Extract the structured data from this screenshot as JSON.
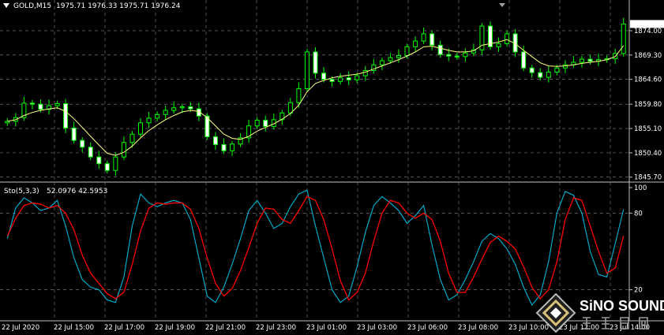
{
  "chart_header": {
    "symbol_label": "GOLD,M15",
    "ohlc_label": "1975.71 1976.33 1975.71 1976.24"
  },
  "indicator_header": {
    "name_label": "Sto(5,3,3)",
    "values_label": "52.0976 42.5953"
  },
  "watermark": {
    "brand_text": "SiNO SOUND"
  },
  "colors": {
    "background": "#000000",
    "grid": "#c0c0c0",
    "candle": "#00ff00",
    "moving_average": "#ffff80",
    "stoch_main": "#00b4d8",
    "stoch_signal": "#ff0000",
    "axis_text": "#ffffff"
  },
  "chart_data": [
    {
      "type": "candlestick",
      "title": "GOLD,M15",
      "y_ticks": [
        1845.7,
        1850.4,
        1855.1,
        1859.8,
        1864.6,
        1869.3,
        1874.0
      ],
      "ylim": [
        1845.2,
        1877.5
      ],
      "x_ticks": [
        "22 Jul 2020",
        "22 Jul 15:00",
        "22 Jul 17:00",
        "22 Jul 19:00",
        "22 Jul 21:00",
        "22 Jul 23:00",
        "23 Jul 01:00",
        "23 Jul 03:00",
        "23 Jul 06:00",
        "23 Jul 08:00",
        "23 Jul 10:00",
        "23 Jul 12:00",
        "23 Jul 14:00"
      ],
      "grid": true,
      "series": [
        {
          "kind": "close",
          "values": [
            1856.5,
            1857.2,
            1860.0,
            1859.8,
            1858.8,
            1859.5,
            1859.9,
            1855.2,
            1852.8,
            1851.5,
            1849.6,
            1848.3,
            1847.0,
            1849.6,
            1852.4,
            1854.0,
            1856.2,
            1857.1,
            1857.8,
            1858.6,
            1859.1,
            1859.3,
            1858.9,
            1857.5,
            1853.5,
            1852.0,
            1850.8,
            1852.1,
            1853.3,
            1855.6,
            1856.7,
            1855.5,
            1856.8,
            1858.1,
            1860.1,
            1862.8,
            1869.9,
            1865.8,
            1864.6,
            1864.2,
            1864.9,
            1864.5,
            1865.3,
            1866.3,
            1867.4,
            1868.2,
            1868.8,
            1869.2,
            1870.9,
            1872.0,
            1873.4,
            1871.2,
            1869.4,
            1869.1,
            1869.0,
            1869.7,
            1870.3,
            1874.9,
            1870.9,
            1871.5,
            1873.4,
            1869.9,
            1866.8,
            1865.9,
            1865.0,
            1866.0,
            1866.8,
            1867.4,
            1867.9,
            1868.5,
            1868.1,
            1868.4,
            1868.6,
            1869.6,
            1875.3
          ]
        },
        {
          "kind": "moving_average",
          "values": [
            1856.5,
            1856.8,
            1857.6,
            1858.2,
            1858.6,
            1858.9,
            1859.1,
            1858.4,
            1857.0,
            1855.3,
            1853.6,
            1851.9,
            1850.3,
            1849.9,
            1850.5,
            1851.7,
            1853.3,
            1854.7,
            1855.8,
            1856.8,
            1857.6,
            1858.3,
            1858.6,
            1858.4,
            1857.2,
            1855.6,
            1854.0,
            1853.2,
            1853.0,
            1853.6,
            1854.6,
            1855.3,
            1856.0,
            1856.9,
            1858.0,
            1859.6,
            1862.2,
            1863.8,
            1864.4,
            1864.9,
            1865.2,
            1865.4,
            1865.6,
            1866.0,
            1866.6,
            1867.2,
            1867.8,
            1868.4,
            1869.1,
            1869.9,
            1870.9,
            1871.0,
            1870.6,
            1870.2,
            1869.9,
            1869.9,
            1870.1,
            1871.2,
            1871.5,
            1871.8,
            1872.3,
            1871.5,
            1870.2,
            1869.0,
            1867.8,
            1867.2,
            1867.1,
            1867.2,
            1867.4,
            1867.7,
            1867.9,
            1868.1,
            1868.4,
            1869.0,
            1871.1
          ]
        }
      ]
    },
    {
      "type": "line",
      "title": "Sto(5,3,3)",
      "y_ticks": [
        20,
        80,
        100
      ],
      "ylim": [
        0,
        100
      ],
      "series": [
        {
          "name": "main",
          "values": [
            60,
            84,
            92,
            88,
            82,
            84,
            90,
            70,
            45,
            28,
            22,
            20,
            12,
            10,
            30,
            70,
            95,
            88,
            85,
            88,
            90,
            88,
            75,
            45,
            15,
            10,
            22,
            40,
            60,
            82,
            90,
            80,
            68,
            72,
            85,
            95,
            98,
            70,
            45,
            20,
            10,
            15,
            38,
            65,
            86,
            93,
            88,
            82,
            72,
            78,
            86,
            55,
            28,
            12,
            16,
            28,
            42,
            58,
            64,
            60,
            52,
            40,
            22,
            8,
            16,
            42,
            80,
            97,
            94,
            80,
            50,
            32,
            30,
            56,
            83
          ]
        },
        {
          "name": "signal",
          "values": [
            62,
            76,
            86,
            88,
            87,
            84,
            86,
            80,
            67,
            47,
            33,
            25,
            17,
            13,
            18,
            40,
            66,
            84,
            88,
            87,
            88,
            88,
            83,
            68,
            45,
            25,
            15,
            21,
            35,
            53,
            72,
            84,
            83,
            75,
            72,
            82,
            93,
            90,
            75,
            52,
            27,
            12,
            18,
            33,
            58,
            80,
            90,
            88,
            80,
            76,
            80,
            75,
            58,
            33,
            18,
            18,
            30,
            44,
            57,
            62,
            58,
            52,
            38,
            22,
            13,
            20,
            42,
            75,
            92,
            90,
            70,
            50,
            33,
            37,
            62
          ]
        }
      ]
    }
  ]
}
